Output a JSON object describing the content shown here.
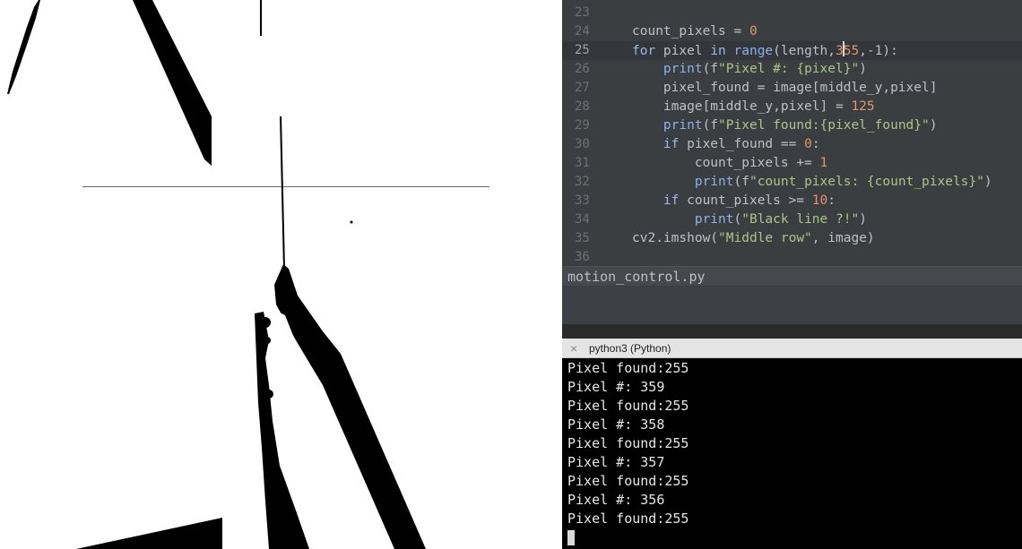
{
  "editor": {
    "lines": [
      {
        "no": "23",
        "html": ""
      },
      {
        "no": "24",
        "html": "count_pixels = <span class=\"num\">0</span>"
      },
      {
        "no": "25",
        "html": "<span class=\"kw\">for</span> pixel <span class=\"kw\">in</span> <span class=\"bi\">range</span>(length,<span class=\"num\">3</span><span class=\"cursor-box\"></span><span class=\"num\">55</span>,-1):"
      },
      {
        "no": "26",
        "html": "    <span class=\"bi\">print</span>(f<span class=\"str\">\"Pixel #: {pixel}\"</span>)"
      },
      {
        "no": "27",
        "html": "    pixel_found = image[middle_y,pixel]"
      },
      {
        "no": "28",
        "html": "    image[middle_y,pixel] = <span class=\"num\">125</span>"
      },
      {
        "no": "29",
        "html": "    <span class=\"bi\">print</span>(f<span class=\"str\">\"Pixel found:{pixel_found}\"</span>)"
      },
      {
        "no": "30",
        "html": "    <span class=\"kw\">if</span> pixel_found == <span class=\"num\">0</span>:"
      },
      {
        "no": "31",
        "html": "        count_pixels += <span class=\"num\">1</span>"
      },
      {
        "no": "32",
        "html": "        <span class=\"bi\">print</span>(f<span class=\"str\">\"count_pixels: {count_pixels}\"</span>)"
      },
      {
        "no": "33",
        "html": "    <span class=\"kw\">if</span> count_pixels >= <span class=\"num\">10</span>:"
      },
      {
        "no": "34",
        "html": "        <span class=\"bi\">print</span>(<span class=\"str\">\"Black line ?!\"</span>)"
      },
      {
        "no": "35",
        "html": "cv2.imshow(<span class=\"str\">\"Middle row\"</span>, image)"
      },
      {
        "no": "36",
        "html": ""
      }
    ],
    "current_line": "25",
    "filename": "motion_control.py"
  },
  "terminal": {
    "title": "python3 (Python)",
    "close_icon": "×",
    "lines": [
      "Pixel found:255",
      "Pixel #: 359",
      "Pixel found:255",
      "Pixel #: 358",
      "Pixel found:255",
      "Pixel #: 357",
      "Pixel found:255",
      "Pixel #: 356",
      "Pixel found:255"
    ]
  },
  "image_window": {
    "icon": "binary-threshold-image"
  }
}
